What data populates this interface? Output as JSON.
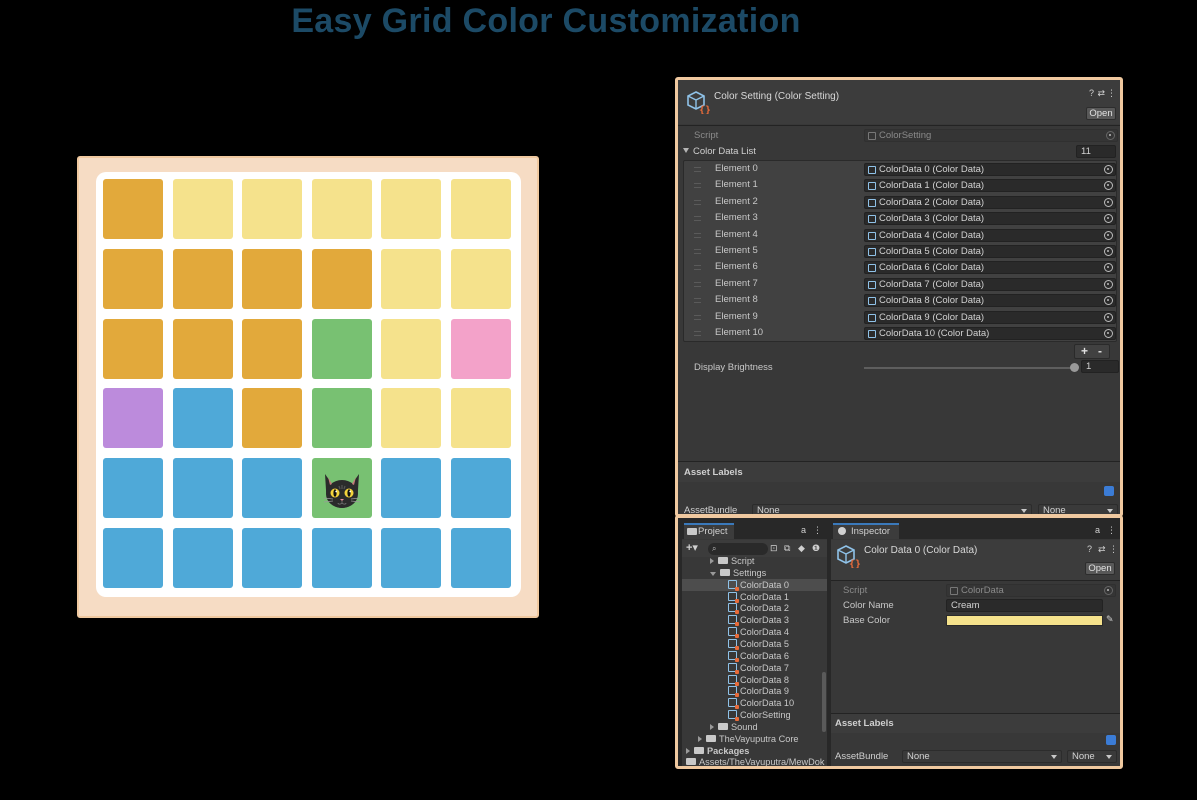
{
  "title": "Easy Grid Color Customization",
  "colors": {
    "orange": "#e2a93b",
    "yellow": "#f5e28c",
    "green": "#78c172",
    "pink": "#f3a2c9",
    "purple": "#bc8bdc",
    "blue": "#4fa9d8",
    "cream_swatch": "#f5e28c",
    "board_border": "#f0c9a0"
  },
  "board": {
    "rows": [
      [
        "orange",
        "yellow",
        "yellow",
        "yellow",
        "yellow",
        "yellow"
      ],
      [
        "orange",
        "orange",
        "orange",
        "orange",
        "yellow",
        "yellow"
      ],
      [
        "orange",
        "orange",
        "orange",
        "green",
        "yellow",
        "pink"
      ],
      [
        "purple",
        "blue",
        "orange",
        "green",
        "yellow",
        "yellow"
      ],
      [
        "blue",
        "blue",
        "blue",
        "green",
        "blue",
        "blue"
      ],
      [
        "blue",
        "blue",
        "blue",
        "blue",
        "blue",
        "blue"
      ]
    ],
    "cat_cell": {
      "row": 4,
      "col": 3
    }
  },
  "inspector_top": {
    "header_title": "Color Setting (Color Setting)",
    "open_button": "Open",
    "script_label": "Script",
    "script_value": "ColorSetting",
    "list_label": "Color Data List",
    "list_count": "11",
    "elements": [
      {
        "label": "Element 0",
        "value": "ColorData 0 (Color Data)"
      },
      {
        "label": "Element 1",
        "value": "ColorData 1 (Color Data)"
      },
      {
        "label": "Element 2",
        "value": "ColorData 2 (Color Data)"
      },
      {
        "label": "Element 3",
        "value": "ColorData 3 (Color Data)"
      },
      {
        "label": "Element 4",
        "value": "ColorData 4 (Color Data)"
      },
      {
        "label": "Element 5",
        "value": "ColorData 5 (Color Data)"
      },
      {
        "label": "Element 6",
        "value": "ColorData 6 (Color Data)"
      },
      {
        "label": "Element 7",
        "value": "ColorData 7 (Color Data)"
      },
      {
        "label": "Element 8",
        "value": "ColorData 8 (Color Data)"
      },
      {
        "label": "Element 9",
        "value": "ColorData 9 (Color Data)"
      },
      {
        "label": "Element 10",
        "value": "ColorData 10 (Color Data)"
      }
    ],
    "add_label": "+",
    "remove_label": "-",
    "brightness_label": "Display Brightness",
    "brightness_value": "1",
    "brightness_level": 1.0,
    "asset_labels": "Asset Labels",
    "assetbundle_label": "AssetBundle",
    "assetbundle_value": "None",
    "variant_value": "None"
  },
  "project": {
    "tab_label": "Project",
    "tree": [
      {
        "label": "Script",
        "kind": "folder",
        "indent": 2
      },
      {
        "label": "Settings",
        "kind": "folder-open",
        "indent": 2
      },
      {
        "label": "ColorData 0",
        "kind": "asset",
        "indent": 3,
        "selected": true
      },
      {
        "label": "ColorData 1",
        "kind": "asset",
        "indent": 3
      },
      {
        "label": "ColorData 2",
        "kind": "asset",
        "indent": 3
      },
      {
        "label": "ColorData 3",
        "kind": "asset",
        "indent": 3
      },
      {
        "label": "ColorData 4",
        "kind": "asset",
        "indent": 3
      },
      {
        "label": "ColorData 5",
        "kind": "asset",
        "indent": 3
      },
      {
        "label": "ColorData 6",
        "kind": "asset",
        "indent": 3
      },
      {
        "label": "ColorData 7",
        "kind": "asset",
        "indent": 3
      },
      {
        "label": "ColorData 8",
        "kind": "asset",
        "indent": 3
      },
      {
        "label": "ColorData 9",
        "kind": "asset",
        "indent": 3
      },
      {
        "label": "ColorData 10",
        "kind": "asset",
        "indent": 3
      },
      {
        "label": "ColorSetting",
        "kind": "asset",
        "indent": 3
      },
      {
        "label": "Sound",
        "kind": "folder",
        "indent": 2
      },
      {
        "label": "TheVayuputra Core",
        "kind": "folder",
        "indent": 1
      },
      {
        "label": "Packages",
        "kind": "folder-bold",
        "indent": 0
      },
      {
        "label": "Assets/TheVayuputra/MewDok",
        "kind": "path",
        "indent": 0
      }
    ]
  },
  "inspector_bottom": {
    "tab_label": "Inspector",
    "header_title": "Color Data 0 (Color Data)",
    "open_button": "Open",
    "script_label": "Script",
    "script_value": "ColorData",
    "color_name_label": "Color Name",
    "color_name_value": "Cream",
    "base_color_label": "Base Color",
    "asset_labels": "Asset Labels",
    "assetbundle_label": "AssetBundle",
    "assetbundle_value": "None",
    "variant_value": "None"
  }
}
